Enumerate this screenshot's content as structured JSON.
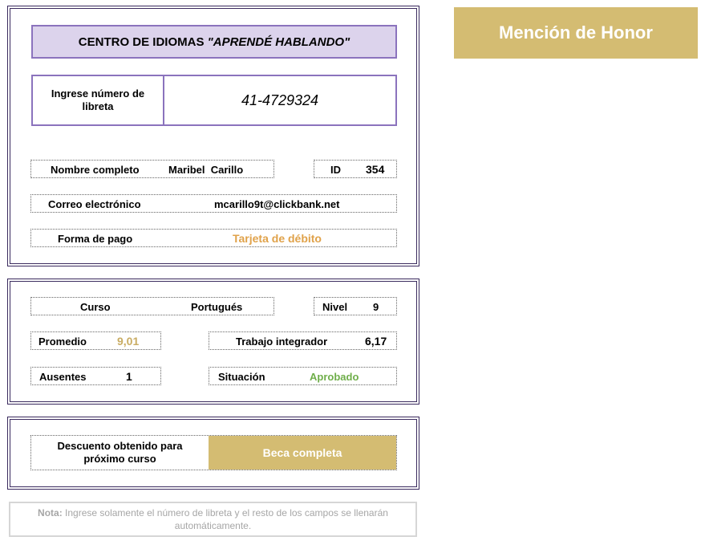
{
  "header": {
    "title_plain": "CENTRO DE IDIOMAS ",
    "title_italic": "\"APRENDÉ HABLANDO\""
  },
  "libreta": {
    "label_line1": "Ingrese número de",
    "label_line2": "libreta",
    "value": "41-4729324"
  },
  "student": {
    "name_label": "Nombre completo",
    "name_value": "Maribel  Carillo",
    "id_label": "ID",
    "id_value": "354",
    "email_label": "Correo electrónico",
    "email_value": "mcarillo9t@clickbank.net",
    "payment_label": "Forma de pago",
    "payment_value": "Tarjeta de débito"
  },
  "course": {
    "course_label": "Curso",
    "course_value": "Portugués",
    "level_label": "Nivel",
    "level_value": "9",
    "avg_label": "Promedio",
    "avg_value": "9,01",
    "project_label": "Trabajo integrador",
    "project_value": "6,17",
    "absences_label": "Ausentes",
    "absences_value": "1",
    "status_label": "Situación",
    "status_value": "Aprobado"
  },
  "discount": {
    "label_line1": "Descuento obtenido para",
    "label_line2": "próximo curso",
    "value": "Beca completa"
  },
  "mention": {
    "label": "Mención de Honor"
  },
  "note": {
    "prefix": "Nota:",
    "text": " Ingrese solamente el número de libreta y el resto de los campos se llenarán automáticamente."
  },
  "colors": {
    "accent_purple": "#8b73bd",
    "title_bg": "#dcd3ec",
    "gold": "#d4bc72",
    "orange_text": "#e0a24a",
    "green_text": "#6fae4a"
  }
}
